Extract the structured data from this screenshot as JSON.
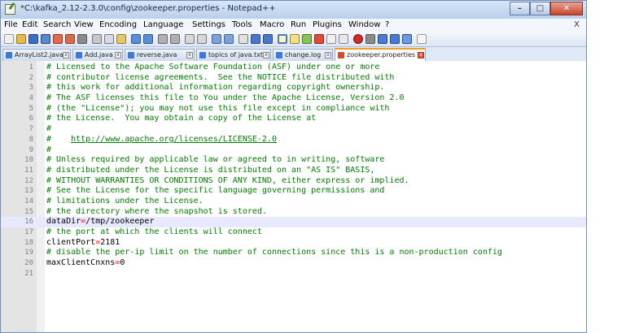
{
  "window": {
    "title": "*C:\\kafka_2.12-2.3.0\\config\\zookeeper.properties - Notepad++",
    "doc_close": "X"
  },
  "menu": [
    "File",
    "Edit",
    "Search",
    "View",
    "Encoding",
    "Language",
    "Settings",
    "Tools",
    "Macro",
    "Run",
    "Plugins",
    "Window",
    "?"
  ],
  "tabs": [
    {
      "label": "ArrayList2.java",
      "active": false
    },
    {
      "label": "Add.java",
      "active": false
    },
    {
      "label": "reverse.java",
      "active": false
    },
    {
      "label": "topics of java.txt",
      "active": false
    },
    {
      "label": "change.log",
      "active": false
    },
    {
      "label": "zookeeper.properties",
      "active": true
    }
  ],
  "tab_close_glyph": "x",
  "editor": {
    "current_line": 16,
    "lines": [
      {
        "n": "1",
        "segs": [
          {
            "t": "# Licensed to the Apache Software Foundation (ASF) under one or more",
            "c": "c"
          }
        ]
      },
      {
        "n": "2",
        "segs": [
          {
            "t": "# contributor license agreements.  See the NOTICE file distributed with",
            "c": "c"
          }
        ]
      },
      {
        "n": "3",
        "segs": [
          {
            "t": "# this work for additional information regarding copyright ownership.",
            "c": "c"
          }
        ]
      },
      {
        "n": "4",
        "segs": [
          {
            "t": "# The ASF licenses this file to You under the Apache License, Version 2.0",
            "c": "c"
          }
        ]
      },
      {
        "n": "5",
        "segs": [
          {
            "t": "# (the \"License\"); you may not use this file except in compliance with",
            "c": "c"
          }
        ]
      },
      {
        "n": "6",
        "segs": [
          {
            "t": "# the License.  You may obtain a copy of the License at",
            "c": "c"
          }
        ]
      },
      {
        "n": "7",
        "segs": [
          {
            "t": "#",
            "c": "c"
          }
        ]
      },
      {
        "n": "8",
        "segs": [
          {
            "t": "#    ",
            "c": "c"
          },
          {
            "t": "http://www.apache.org/licenses/LICENSE-2.0",
            "c": "u"
          }
        ]
      },
      {
        "n": "9",
        "segs": [
          {
            "t": "#",
            "c": "c"
          }
        ]
      },
      {
        "n": "10",
        "segs": [
          {
            "t": "# Unless required by applicable law or agreed to in writing, software",
            "c": "c"
          }
        ]
      },
      {
        "n": "11",
        "segs": [
          {
            "t": "# distributed under the License is distributed on an \"AS IS\" BASIS,",
            "c": "c"
          }
        ]
      },
      {
        "n": "12",
        "segs": [
          {
            "t": "# WITHOUT WARRANTIES OR CONDITIONS OF ANY KIND, either express or implied.",
            "c": "c"
          }
        ]
      },
      {
        "n": "13",
        "segs": [
          {
            "t": "# See the License for the specific language governing permissions and",
            "c": "c"
          }
        ]
      },
      {
        "n": "14",
        "segs": [
          {
            "t": "# limitations under the License.",
            "c": "c"
          }
        ]
      },
      {
        "n": "15",
        "segs": [
          {
            "t": "# the directory where the snapshot is stored.",
            "c": "c"
          }
        ]
      },
      {
        "n": "16",
        "segs": [
          {
            "t": "dataDir",
            "c": "k"
          },
          {
            "t": "=",
            "c": "op"
          },
          {
            "t": "/tmp/zookeeper",
            "c": "v"
          }
        ]
      },
      {
        "n": "17",
        "segs": [
          {
            "t": "# the port at which the clients will connect",
            "c": "c"
          }
        ]
      },
      {
        "n": "18",
        "segs": [
          {
            "t": "clientPort",
            "c": "k"
          },
          {
            "t": "=",
            "c": "op"
          },
          {
            "t": "2181",
            "c": "v"
          }
        ]
      },
      {
        "n": "19",
        "segs": [
          {
            "t": "# disable the per-ip limit on the number of connections since this is a non-production config",
            "c": "c"
          }
        ]
      },
      {
        "n": "20",
        "segs": [
          {
            "t": "maxClientCnxns",
            "c": "k"
          },
          {
            "t": "=",
            "c": "op"
          },
          {
            "t": "0",
            "c": "v"
          }
        ]
      },
      {
        "n": "21",
        "segs": []
      }
    ]
  }
}
